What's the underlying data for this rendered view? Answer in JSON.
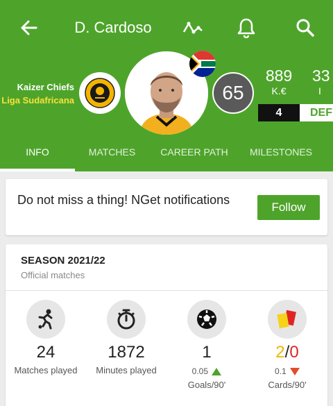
{
  "header": {
    "title": "D. Cardoso",
    "club": "Kaizer Chiefs",
    "league": "Liga Sudafricana",
    "club_logo_text": "KAIZER CHIEFS",
    "rating": "65",
    "value_amount": "889",
    "value_unit": "K.€",
    "age": "33",
    "age_unit": "I",
    "shirt_number": "4",
    "position": "DEF",
    "icons": [
      "back-arrow-icon",
      "trend-line-icon",
      "bell-icon",
      "search-icon"
    ]
  },
  "tabs": [
    {
      "label": "INFO",
      "active": true
    },
    {
      "label": "MATCHES"
    },
    {
      "label": "CAREER PATH"
    },
    {
      "label": "MILESTONES"
    }
  ],
  "notification": {
    "text": "Do not miss a thing!  NGet notifications",
    "button": "Follow"
  },
  "season": {
    "title": "SEASON 2021/22",
    "subtitle": "Official matches",
    "stats": [
      {
        "icon": "player-kicking-icon",
        "value": "24",
        "label": "Matches played"
      },
      {
        "icon": "stopwatch-icon",
        "value": "1872",
        "label": "Minutes played"
      },
      {
        "icon": "football-icon",
        "value": "1",
        "per90": "0.05",
        "label": "Goals/90'"
      },
      {
        "icon": "cards-icon",
        "yellow": "2",
        "sep": "/",
        "red": "0",
        "per90": "0.1",
        "label": "Cards/90'"
      }
    ]
  },
  "colors": {
    "brand_green": "#4ea42b",
    "rating_bg": "#5a5a5a",
    "yellow_card": "#f0b400",
    "red_card": "#e02424"
  }
}
